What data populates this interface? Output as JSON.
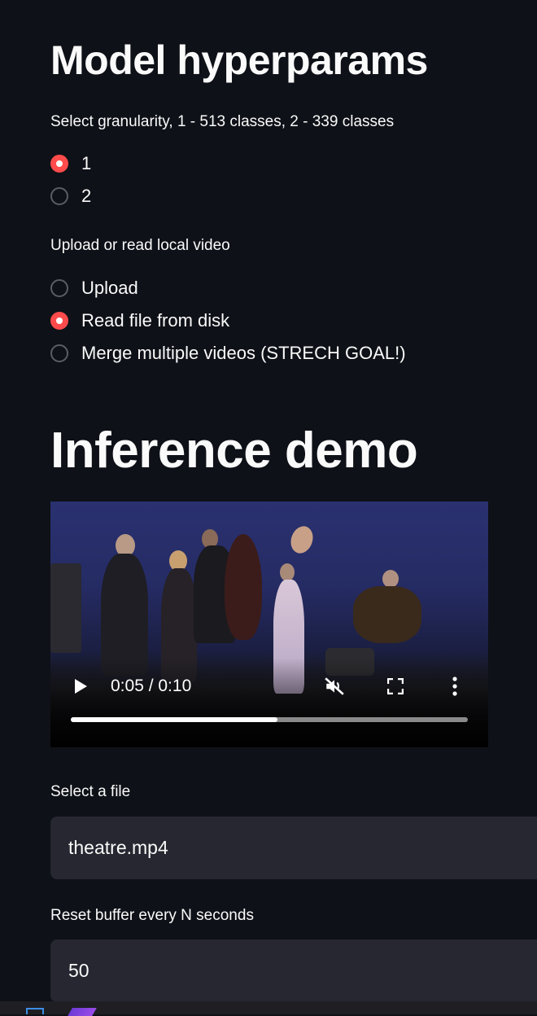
{
  "hyperparams": {
    "title": "Model hyperparams",
    "granularity_label": "Select granularity, 1 - 513 classes, 2 - 339 classes",
    "granularity_options": [
      "1",
      "2"
    ],
    "granularity_selected": 0
  },
  "source": {
    "label": "Upload or read local video",
    "options": [
      "Upload",
      "Read file from disk",
      "Merge multiple videos (STRECH GOAL!)"
    ],
    "selected": 1
  },
  "inference": {
    "title": "Inference demo"
  },
  "video": {
    "time": "0:05 / 0:10",
    "progress": 0.52
  },
  "file_select": {
    "label": "Select a file",
    "value": "theatre.mp4"
  },
  "buffer": {
    "label": "Reset buffer every N seconds",
    "value": "50"
  },
  "colors": {
    "background": "#0e1117",
    "accent": "#ff4b4b",
    "input_bg": "#262730"
  },
  "icons": [
    "play-icon",
    "mute-icon",
    "fullscreen-icon",
    "more-vert-icon"
  ]
}
